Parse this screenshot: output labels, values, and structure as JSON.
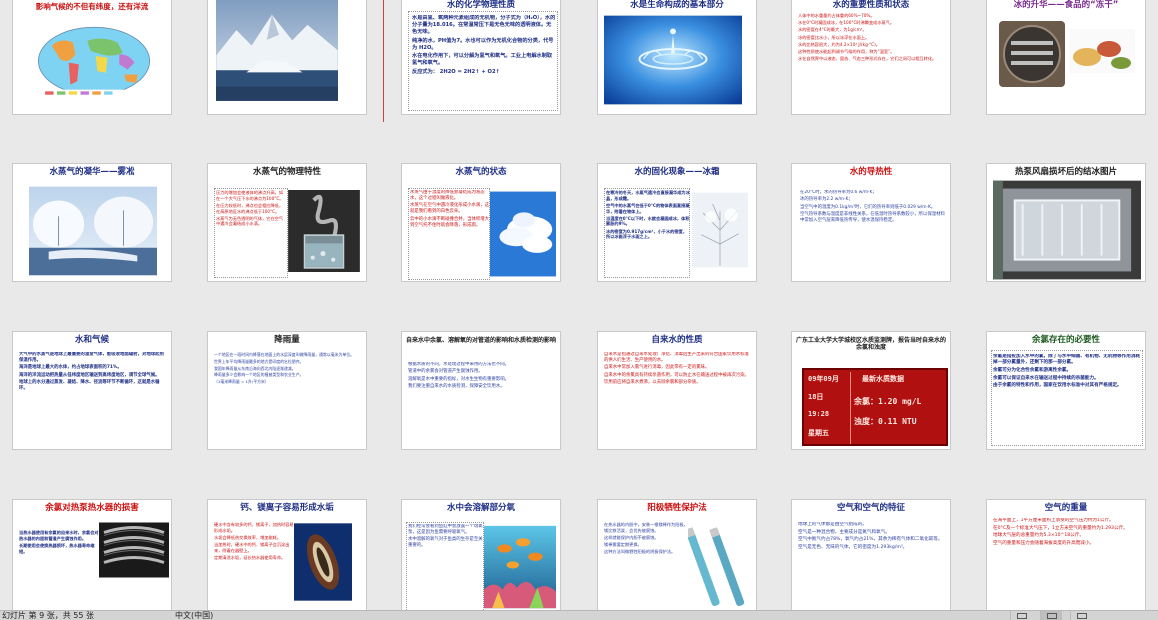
{
  "slides": [
    {
      "id": "s1",
      "title": "影响气候的不但有纬度，还有洋流",
      "title_color": "red",
      "picture": "world-climate-map"
    },
    {
      "id": "s2",
      "title": "",
      "picture": "snowy-mountains-iceberg"
    },
    {
      "id": "s3",
      "title": "水的化学物理性质",
      "title_color": "navy",
      "paragraphs": [
        "水是由氢、氧两种元素组成的无机物，分子式为（H₂O），水的分子量为18.016。在常温常压下是无色无味的透明液体。无色无味。",
        "纯净的水，PH值为7。水也可以作为无机化合物的分类，代号为 H2O。",
        "水在电化作用下，可以分解为氢气和氧气。工业上电解水制取氢气和氧气。",
        "反应式为： 2H2O = 2H2↑ + O2↑"
      ]
    },
    {
      "id": "s4",
      "title": "水是生命构成的基本部分",
      "title_color": "navy",
      "picture": "water-splash-drop"
    },
    {
      "id": "s5",
      "title": "水的重要性质和状态",
      "title_color": "navy",
      "paragraphs": [
        "人体中的水重量约占体重的60%~70%。",
        "水在0°C时凝固成冰，在100°C时沸腾变成水蒸气。",
        "水的密度在4°C时最大，为1g/cm³。",
        "冰的密度比水小，所以冰浮在水面上。",
        "水的比热容很大，约为4.2×10³ J/(kg·°C)。",
        "这种性质使水能起到调节气候的作用，称为“温室”。",
        "水在自然界中以液态、固态、气态三种形式存在，它们之间可以相互转化。"
      ]
    },
    {
      "id": "s6",
      "title": "冰的升华——食品的“冻干”",
      "title_color": "purple",
      "picture": "freeze-dryer-food"
    },
    {
      "id": "s7",
      "title": "水蒸气的凝华——雾凇",
      "title_color": "navy",
      "picture": "frost-rime-lake"
    },
    {
      "id": "s8",
      "title": "水蒸气的物理特性",
      "title_color": "dark",
      "paragraphs": [
        "压力的增加会使液体的沸点升高，如在一个大气压下水的沸点为100°C。",
        "在压力较低时，沸点也会相应降低，在高原地区水的沸点低于100°C。",
        "水蒸气为无色透明的气体，它在空气中遇冷会凝结成小水滴。"
      ],
      "picture": "steam-beaker"
    },
    {
      "id": "s9",
      "title": "水蒸气的状态",
      "title_color": "navy",
      "paragraphs": [
        "水蒸气由于温度的降低会凝结成为液态水，这个过程叫做液化。",
        "水蒸气在空气中遇冷液化形成小水滴，这就是我们看到的白色云朵。",
        "云中的小水滴不断碰撞合并，当体积增大到空气托不住时就会降落，形成雨。"
      ],
      "picture": "blue-sky-clouds"
    },
    {
      "id": "s10",
      "title": "水的固化现象——冰霜",
      "title_color": "navy",
      "paragraphs": [
        "在寒冷的冬天，水蒸气遇冷会直接凝华成为冰晶，形成霜。",
        "空气中的水蒸气在低于0°C的物体表面直接凝华，附着在物体上。",
        "当温度在0°C以下时，水就会凝固成冰，体积膨胀约9%。",
        "冰的密度为0.917g/cm³，小于水的密度，所以冰能浮于水面之上。"
      ],
      "picture": "frost-tree"
    },
    {
      "id": "s11",
      "title": "水的导热性",
      "title_color": "red",
      "paragraphs": [
        "在20°C时，水的热导率为0.6 w/m·K；",
        "冰的热导率为2.2 w/m·K；",
        "当空气中的温度为0.1kg/m³时，它们的热导率则低于0.029 w/m·K。",
        "空气热导系数与温度是非线性关系，在低温时热导系数较小，所以保温材料中常加入空气层来降低热传导，使水温保持稳定。"
      ]
    },
    {
      "id": "s12",
      "title": "热泵风扇损坏后的结冰图片",
      "title_color": "dark",
      "picture": "frozen-heat-pump"
    },
    {
      "id": "s13",
      "title": "水和气候",
      "title_color": "navy",
      "paragraphs": [
        "大气中的水蒸气是地球上最重要的温室气体，能吸收地面辐射，对地球起到保温作用。",
        "海洋是地球上最大的水体，约占地球表面积的71%。",
        "海洋的洋流运动把热量从低纬度地区输送到高纬度地区，调节全球气候。",
        "地球上的水分通过蒸发、凝结、降水、径流等环节不断循环，这就是水循环。"
      ]
    },
    {
      "id": "s14",
      "title": "降雨量",
      "title_color": "dark",
      "paragraphs": [
        "一个地区在一段时间内降落在地面上的水层深度叫做降雨量，通常以毫米为单位。",
        "世界上年平均降雨量最多的地方是印度的乞拉朋齐。",
        "我国年降雨量从东南沿海向西北内陆逐渐递减。",
        "降雨量多少会影响一个地区的植被类型和农业生产。",
        "（1毫米降雨量 = 1升/平方米）"
      ]
    },
    {
      "id": "s15",
      "title": "自来水中余氯、溶解氧的对管道的影响和水质检测的影响",
      "title_color": "dark",
      "paragraphs": [
        "根据水质的不同，水处理过程中采用的方法也不同。",
        "管道中的余氯会对管道产生腐蚀作用。",
        "溶解氧是水中重要的指标，对水生生物有重要影响。",
        "我们要注重自来水的水质检测，保障安全饮用水。"
      ]
    },
    {
      "id": "s16",
      "title": "自来水的性质",
      "title_color": "navy",
      "paragraphs": [
        "自来水是指通过自来水处理厂净化、消毒后生产出来的符合国家饮用水标准的供人们生活、生产使用的水。",
        "自来水中常加入氯气进行消毒，因此带有一定的氯味。",
        "自来水中的余氯具有持续杀菌作用，可以防止水在输送过程中被再次污染。",
        "饮用前应将自来水煮沸，以去除余氯和部分杂质。"
      ]
    },
    {
      "id": "s17",
      "title": "广东工业大学大学城校区水质监测牌，报告当时自来水的余氯和浊度",
      "title_color": "dark",
      "led": {
        "date": "09年09月",
        "day": "18日",
        "time": "19:28",
        "weekday": "星期五",
        "heading": "最新水质数据",
        "chlorine": "余氯：1.20 mg/L",
        "turbidity": "浊度：0.11 NTU"
      }
    },
    {
      "id": "s18",
      "title": "余氯存在的必要性",
      "title_color": "green",
      "paragraphs": [
        "余氯是指投加入水中的氯，除了与水中细菌、有机物、无机物等作用消耗掉一部分氯量外，还剩下的那一部分氯。",
        "余氯可分为化合性余氯和游离性余氯。",
        "余氯可以保证自来水在输送过程中持续的杀菌能力。",
        "由于余氯的特性和作用，国家在饮用水标准中对其有严格规定。"
      ]
    },
    {
      "id": "s19",
      "title": "余氯对热泵热水器的损害",
      "title_color": "red",
      "paragraphs": [
        "当热水器使用有余氯的自来水时，余氯会对热水器的内胆和管道产生腐蚀作用。",
        "长期使用会使换热器损坏，热水器寿命缩短。"
      ],
      "picture": "corroded-pipe"
    },
    {
      "id": "s20",
      "title": "钙、镁离子容易形成水垢",
      "title_color": "navy",
      "paragraphs": [
        "硬水中含有较多的钙、镁离子，加热时容易形成水垢。",
        "水垢会降低热交换效率，增加能耗。",
        "当加热时，硬水中的钙、镁离子会沉淀出来，附着在器壁上。",
        "定期清洗水垢，延长热水器使用寿命。"
      ],
      "picture": "scale-pipe"
    },
    {
      "id": "s21",
      "title": "水中会溶解部分氧",
      "title_color": "navy",
      "paragraphs": [
        "我们经常会看到鱼缸中会放置一个增氧泵，这是因为鱼需要呼吸氧气。",
        "水中溶解的氧气对于鱼类的生存是至关重要的。"
      ],
      "picture": "fish-coral"
    },
    {
      "id": "s22",
      "title": "阳极牺牲保护法",
      "title_color": "red",
      "paragraphs": [
        "在热水器的内胆中，安装一根镁棒作为阳极，镁比铁活泼，会优先被腐蚀。",
        "这样就能保护内胆不被腐蚀。",
        "镁棒需要定期更换。",
        "这种方法叫做牺牲阳极的阴极保护法。"
      ],
      "picture": "magnesium-rods"
    },
    {
      "id": "s23",
      "title": "空气和空气的特征",
      "title_color": "navy",
      "paragraphs": [
        "地球上的气体都是由空气组成的。",
        "空气是一种混合物，主要成分是氮气和氧气。",
        "空气中氮气约占78%，氧气约占21%，其余为稀有气体和二氧化碳等。",
        "空气是无色、无味的气体，它的密度为1.293kg/m³。"
      ]
    },
    {
      "id": "s24",
      "title": "空气的重量",
      "title_color": "navy",
      "paragraphs": [
        "在海平面上，1平方厘米面积上承受的空气压力约为1公斤。",
        "在0°C及一个标准大气压下，1立方米空气的重量约为1.293公斤。",
        "地球大气层的总重量约为5.3×10^18公斤。",
        "空气的重量和压力会随着海拔高度的升高而减小。"
      ]
    }
  ],
  "status": {
    "slide_info": "幻灯片 第 9 张，共 55 张",
    "language": "中文(中国)"
  }
}
